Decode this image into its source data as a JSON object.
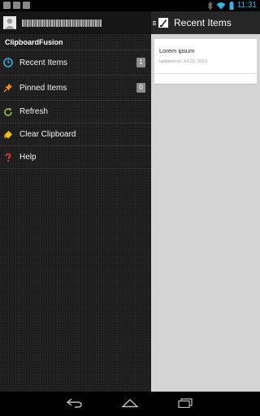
{
  "status_bar": {
    "time": "11:31",
    "left_icons": [
      "image-notification-icon",
      "video-notification-icon",
      "video-notification-icon"
    ],
    "right_icons": [
      "bluetooth-icon",
      "wifi-icon",
      "battery-icon"
    ],
    "accent": "#33b5e5"
  },
  "drawer": {
    "account_name": "",
    "app_title": "ClipboardFusion",
    "items": [
      {
        "label": "Recent Items",
        "icon": "clock-icon",
        "badge": "1"
      },
      {
        "label": "Pinned Items",
        "icon": "pin-icon",
        "badge": "0"
      },
      {
        "label": "Refresh",
        "icon": "refresh-icon"
      },
      {
        "label": "Clear Clipboard",
        "icon": "eraser-icon"
      },
      {
        "label": "Help",
        "icon": "question-icon"
      }
    ]
  },
  "main": {
    "title": "Recent Items",
    "cards": [
      {
        "title": "Lorem ipsum",
        "subtitle": "updated on Jul 22, 2013"
      }
    ]
  },
  "nav_bar": {
    "buttons": [
      "back-icon",
      "home-icon",
      "recents-icon"
    ]
  }
}
